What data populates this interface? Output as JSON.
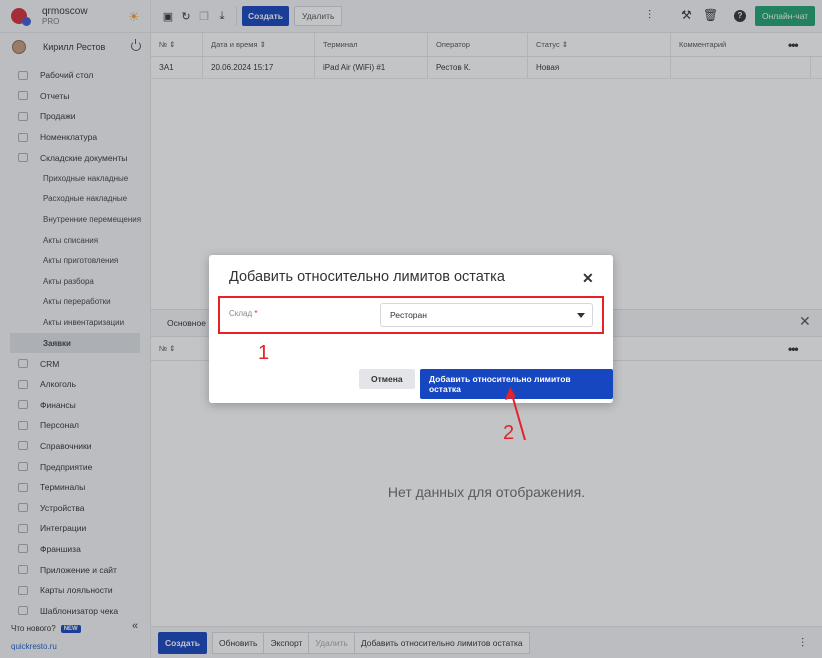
{
  "brand": {
    "name": "qrmoscow",
    "plan": "PRO"
  },
  "user": {
    "name": "Кирилл Рестов"
  },
  "sidebar": {
    "items": [
      {
        "label": "Рабочий стол"
      },
      {
        "label": "Отчеты"
      },
      {
        "label": "Продажи"
      },
      {
        "label": "Номенклатура"
      },
      {
        "label": "Складские документы"
      }
    ],
    "subitems": [
      {
        "label": "Приходные накладные"
      },
      {
        "label": "Расходные накладные"
      },
      {
        "label": "Внутренние перемещения"
      },
      {
        "label": "Акты списания"
      },
      {
        "label": "Акты приготовления"
      },
      {
        "label": "Акты разбора"
      },
      {
        "label": "Акты переработки"
      },
      {
        "label": "Акты инвентаризации"
      },
      {
        "label": "Заявки"
      }
    ],
    "items2": [
      {
        "label": "CRM"
      },
      {
        "label": "Алкоголь"
      },
      {
        "label": "Финансы"
      },
      {
        "label": "Персонал"
      },
      {
        "label": "Справочники"
      },
      {
        "label": "Предприятие"
      },
      {
        "label": "Терминалы"
      },
      {
        "label": "Устройства"
      },
      {
        "label": "Интеграции"
      },
      {
        "label": "Франшиза"
      },
      {
        "label": "Приложение и сайт"
      },
      {
        "label": "Карты лояльности"
      },
      {
        "label": "Шаблонизатор чека"
      }
    ],
    "whats_new": "Что нового?",
    "new_badge": "NEW",
    "footer_link": "quickresto.ru"
  },
  "toolbar": {
    "create_label": "Создать",
    "delete_label": "Удалить",
    "chat_label": "Онлайн-чат"
  },
  "grid": {
    "columns": [
      "№",
      "Дата и время",
      "Терминал",
      "Оператор",
      "Статус",
      "Комментарий"
    ],
    "rows": [
      {
        "num": "ЗА1",
        "datetime": "20.06.2024 15:17",
        "terminal": "iPad Air (WiFi) #1",
        "operator": "Рестов К.",
        "status": "Новая",
        "comment": ""
      }
    ]
  },
  "detail": {
    "tab_label": "Основное",
    "column_num": "№",
    "empty_message": "Нет данных для отображения."
  },
  "actionbar": {
    "create": "Создать",
    "refresh": "Обновить",
    "export": "Экспорт",
    "delete": "Удалить",
    "add_limits": "Добавить относительно лимитов остатка"
  },
  "modal": {
    "title": "Добавить относительно лимитов остатка",
    "field_label": "Склад",
    "required_mark": "*",
    "select_value": "Ресторан",
    "cancel_label": "Отмена",
    "confirm_label": "Добавить относительно лимитов остатка"
  },
  "annotations": {
    "n1": "1",
    "n2": "2"
  },
  "colors": {
    "accent": "#1646c0",
    "chat": "#21a26f",
    "annotation": "#e52226"
  }
}
